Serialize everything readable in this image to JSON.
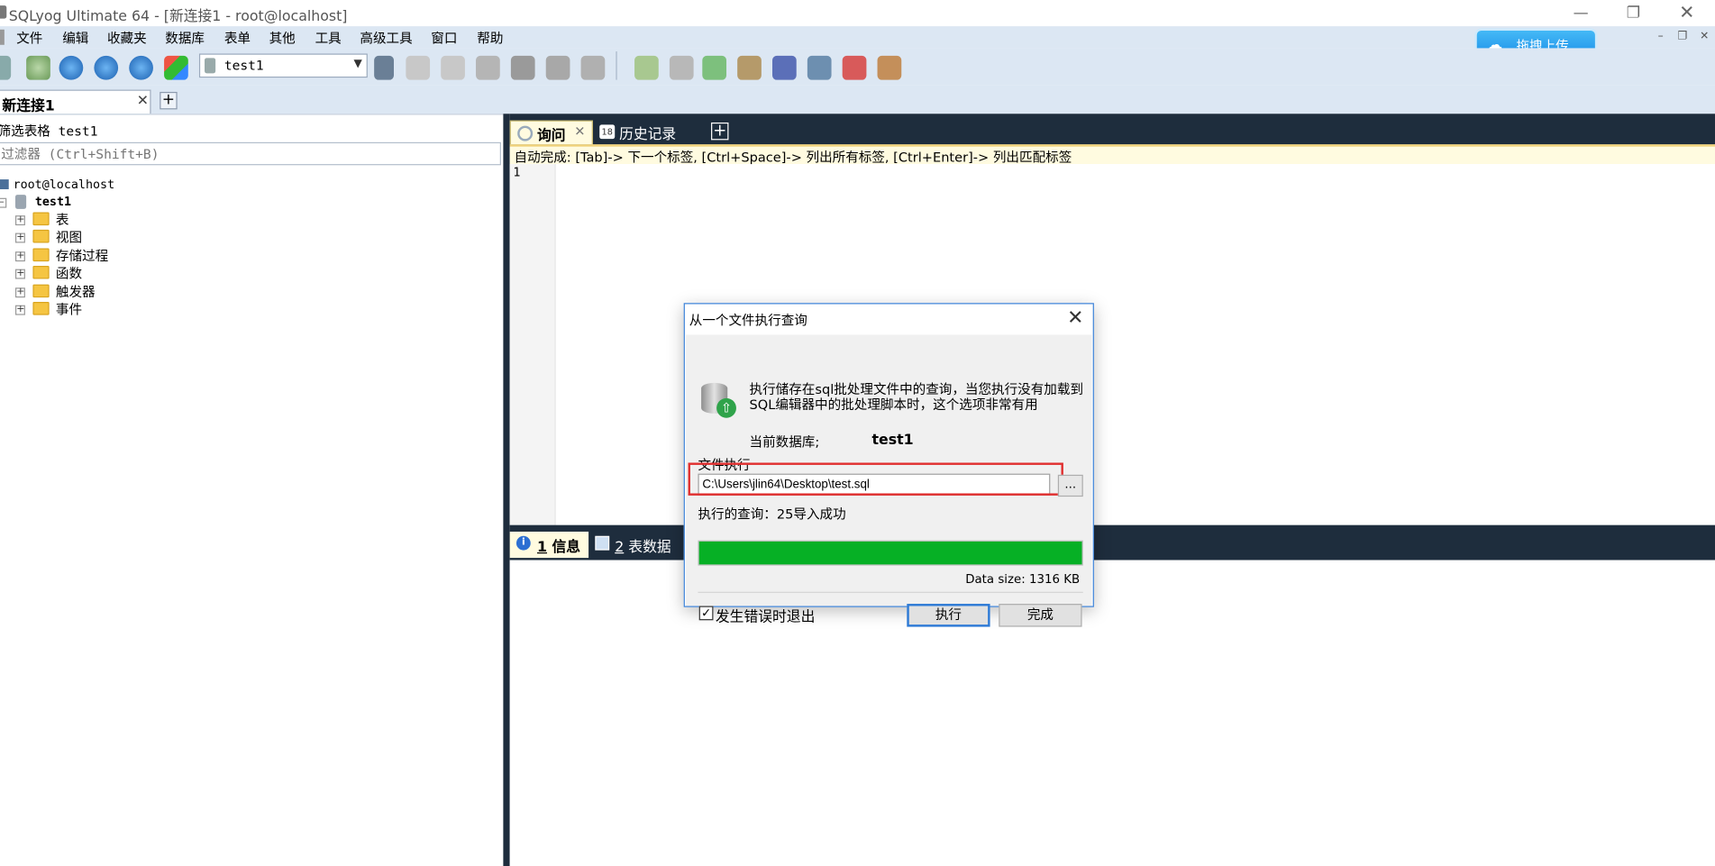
{
  "window": {
    "title": "SQLyog Ultimate 64 - [新连接1 - root@localhost]"
  },
  "menu": [
    "文件",
    "编辑",
    "收藏夹",
    "数据库",
    "表单",
    "其他",
    "工具",
    "高级工具",
    "窗口",
    "帮助"
  ],
  "baidu_button": {
    "label": "拖拽上传"
  },
  "toolbar": {
    "database_select": "test1"
  },
  "connection_tab": {
    "label": "新连接1"
  },
  "object_browser": {
    "filter_label": "筛选表格 test1",
    "filter_placeholder": "过滤器 (Ctrl+Shift+B)",
    "root": "root@localhost",
    "database": "test1",
    "folders": [
      "表",
      "视图",
      "存储过程",
      "函数",
      "触发器",
      "事件"
    ]
  },
  "query_tabs": {
    "query": "询问",
    "history": "历史记录"
  },
  "hint": "自动完成: [Tab]-> 下一个标签, [Ctrl+Space]-> 列出所有标签, [Ctrl+Enter]-> 列出匹配标签",
  "editor": {
    "line_number": "1"
  },
  "result_tabs": {
    "tab1_num": "1",
    "tab1_label": "信息",
    "tab2_num": "2",
    "tab2_label": "表数据"
  },
  "dialog": {
    "title": "从一个文件执行查询",
    "description": "执行储存在sql批处理文件中的查询，当您执行没有加载到SQL编辑器中的批处理脚本时，这个选项非常有用",
    "current_db_label": "当前数据库;",
    "current_db_value": "test1",
    "file_exec_label": "文件执行",
    "file_path": "C:\\Users\\jlin64\\Desktop\\test.sql",
    "browse_label": "...",
    "executed_queries": "执行的查询：25导入成功",
    "progress": 1.0,
    "progress_color": "#06b025",
    "data_size": "Data size: 1316 KB",
    "exit_on_error_label": "发生错误时退出",
    "exit_on_error_checked": true,
    "execute_button": "执行",
    "done_button": "完成"
  },
  "colors": {
    "dark_panel": "#1e2d3d",
    "toolbar_bg": "#dce7f3",
    "query_tab": "#fffbe0",
    "dialog_border": "#3c82d8",
    "highlight_box": "#e03030"
  }
}
